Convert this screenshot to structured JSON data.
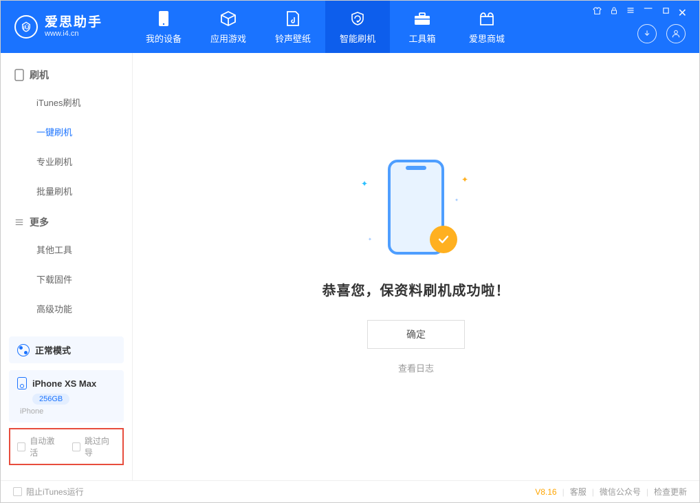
{
  "app": {
    "title": "爱思助手",
    "subtitle": "www.i4.cn"
  },
  "nav": {
    "tabs": [
      {
        "label": "我的设备"
      },
      {
        "label": "应用游戏"
      },
      {
        "label": "铃声壁纸"
      },
      {
        "label": "智能刷机"
      },
      {
        "label": "工具箱"
      },
      {
        "label": "爱思商城"
      }
    ]
  },
  "sidebar": {
    "section1": {
      "title": "刷机"
    },
    "items1": [
      {
        "label": "iTunes刷机"
      },
      {
        "label": "一键刷机"
      },
      {
        "label": "专业刷机"
      },
      {
        "label": "批量刷机"
      }
    ],
    "section2": {
      "title": "更多"
    },
    "items2": [
      {
        "label": "其他工具"
      },
      {
        "label": "下载固件"
      },
      {
        "label": "高级功能"
      }
    ],
    "mode_label": "正常模式",
    "device_name": "iPhone XS Max",
    "device_storage": "256GB",
    "device_type": "iPhone",
    "auto_activate": "自动激活",
    "skip_guide": "跳过向导"
  },
  "content": {
    "success_message": "恭喜您，保资料刷机成功啦！",
    "ok_button": "确定",
    "view_log": "查看日志"
  },
  "footer": {
    "block_itunes": "阻止iTunes运行",
    "version": "V8.16",
    "support": "客服",
    "wechat": "微信公众号",
    "update": "检查更新"
  }
}
